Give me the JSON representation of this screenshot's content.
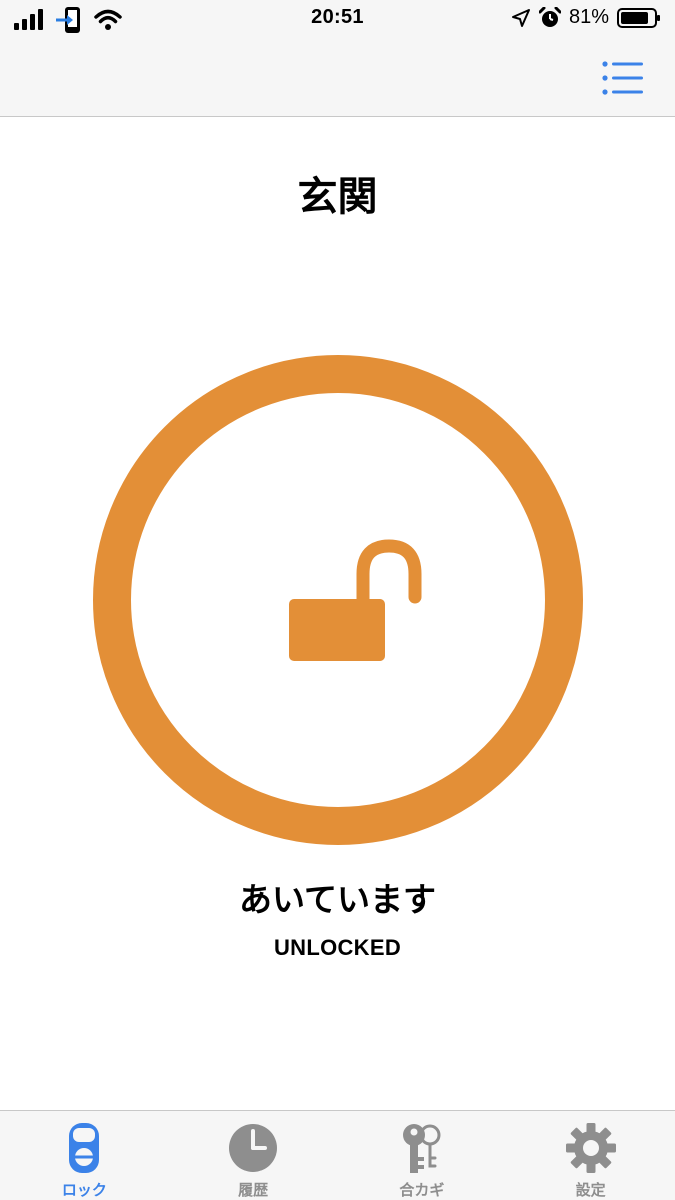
{
  "status_bar": {
    "time": "20:51",
    "battery_percent": "81%"
  },
  "nav_bar": {
    "menu_icon": "list-icon"
  },
  "main": {
    "title": "玄関",
    "lock_state_jp": "あいています",
    "lock_state_en": "UNLOCKED",
    "accent_color": "#E38F37",
    "lock_icon": "unlocked-padlock-icon"
  },
  "tab_bar": {
    "active_color": "#3B82E8",
    "inactive_color": "#8E8E8E",
    "tabs": [
      {
        "label": "ロック",
        "icon": "lock-device-icon",
        "active": true
      },
      {
        "label": "履歴",
        "icon": "clock-icon",
        "active": false
      },
      {
        "label": "合カギ",
        "icon": "keys-icon",
        "active": false
      },
      {
        "label": "設定",
        "icon": "gear-icon",
        "active": false
      }
    ]
  }
}
